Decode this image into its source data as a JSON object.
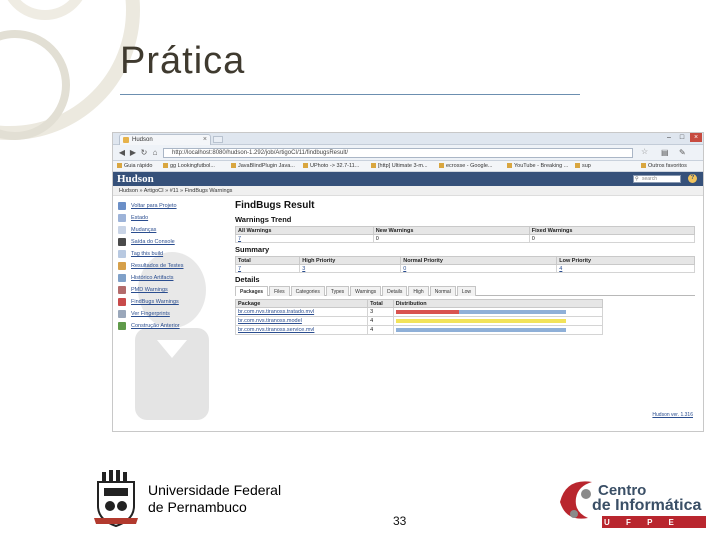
{
  "slide": {
    "title": "Prática",
    "institution_line1": "Universidade Federal",
    "institution_line2": "de Pernambuco",
    "page_number": "33",
    "logo_right_line1": "Centro",
    "logo_right_line2": "de Informática",
    "logo_right_line3": "U F P E"
  },
  "browser": {
    "tab_title": "Hudson",
    "tab_close": "×",
    "url": "http://localhost:8080/hudson-1.292/job/ArtigoCI/11/findbugsResult/",
    "bookmarks": [
      "Guia rápido",
      "gg Lookingfutbol...",
      "JavaBlindPlugin Java...",
      "UPhoto -> 32.7-11...",
      "[http] Ultimate 3-m...",
      "ecrosse - Google...",
      "YouTube - Breaking ...",
      "sup",
      "Outros favoritos"
    ]
  },
  "hudson": {
    "logo": "Hudson",
    "search_placeholder": "search",
    "help": "?",
    "breadcrumb": "Hudson » ArtigoCI » #11 » FindBugs Warnings",
    "sidebar": [
      {
        "label": "Voltar para Projeto",
        "color": "#6b8fc7"
      },
      {
        "label": "Estado",
        "color": "#9db3d8"
      },
      {
        "label": "Mudanças",
        "color": "#c9d4e6"
      },
      {
        "label": "Saída do Console",
        "color": "#4a4a4a"
      },
      {
        "label": "Tag this build",
        "color": "#b8c9e1"
      },
      {
        "label": "Resultados de Testes",
        "color": "#d6a04a"
      },
      {
        "label": "Histórico Artifacts",
        "color": "#7fa0c8"
      },
      {
        "label": "PMD Warnings",
        "color": "#b36b6b"
      },
      {
        "label": "FindBugs Warnings",
        "color": "#c84a4a"
      },
      {
        "label": "Ver Fingerprints",
        "color": "#9aa7ba"
      },
      {
        "label": "Construção Anterior",
        "color": "#5f9a4a"
      }
    ],
    "main_title": "FindBugs Result",
    "trend_title": "Warnings Trend",
    "trend_headers": [
      "All Warnings",
      "New Warnings",
      "Fixed Warnings"
    ],
    "trend_values": [
      "7",
      "0",
      "0"
    ],
    "summary_title": "Summary",
    "summary_headers": [
      "Total",
      "High Priority",
      "Normal Priority",
      "Low Priority"
    ],
    "summary_values": [
      "7",
      "3",
      "0",
      "4"
    ],
    "details_title": "Details",
    "detail_tabs": [
      "Packages",
      "Files",
      "Categories",
      "Types",
      "Warnings",
      "Details",
      "High",
      "Normal",
      "Low"
    ],
    "details_headers": [
      "Package",
      "Total",
      "Distribution"
    ],
    "details_rows": [
      {
        "package": "br.com.nvs.tiranoss.tratado.mvl",
        "total": "3",
        "red": 0.37,
        "blue": 0.63,
        "yellow": 0
      },
      {
        "package": "br.com.nvs.tiranoss.model",
        "total": "4",
        "red": 0,
        "blue": 0,
        "yellow": 1
      },
      {
        "package": "br.com.nvs.tiranoss.service.mvl",
        "total": "4",
        "red": 0,
        "blue": 1,
        "yellow": 0
      }
    ],
    "version": "Hudson ver. 1.316"
  }
}
